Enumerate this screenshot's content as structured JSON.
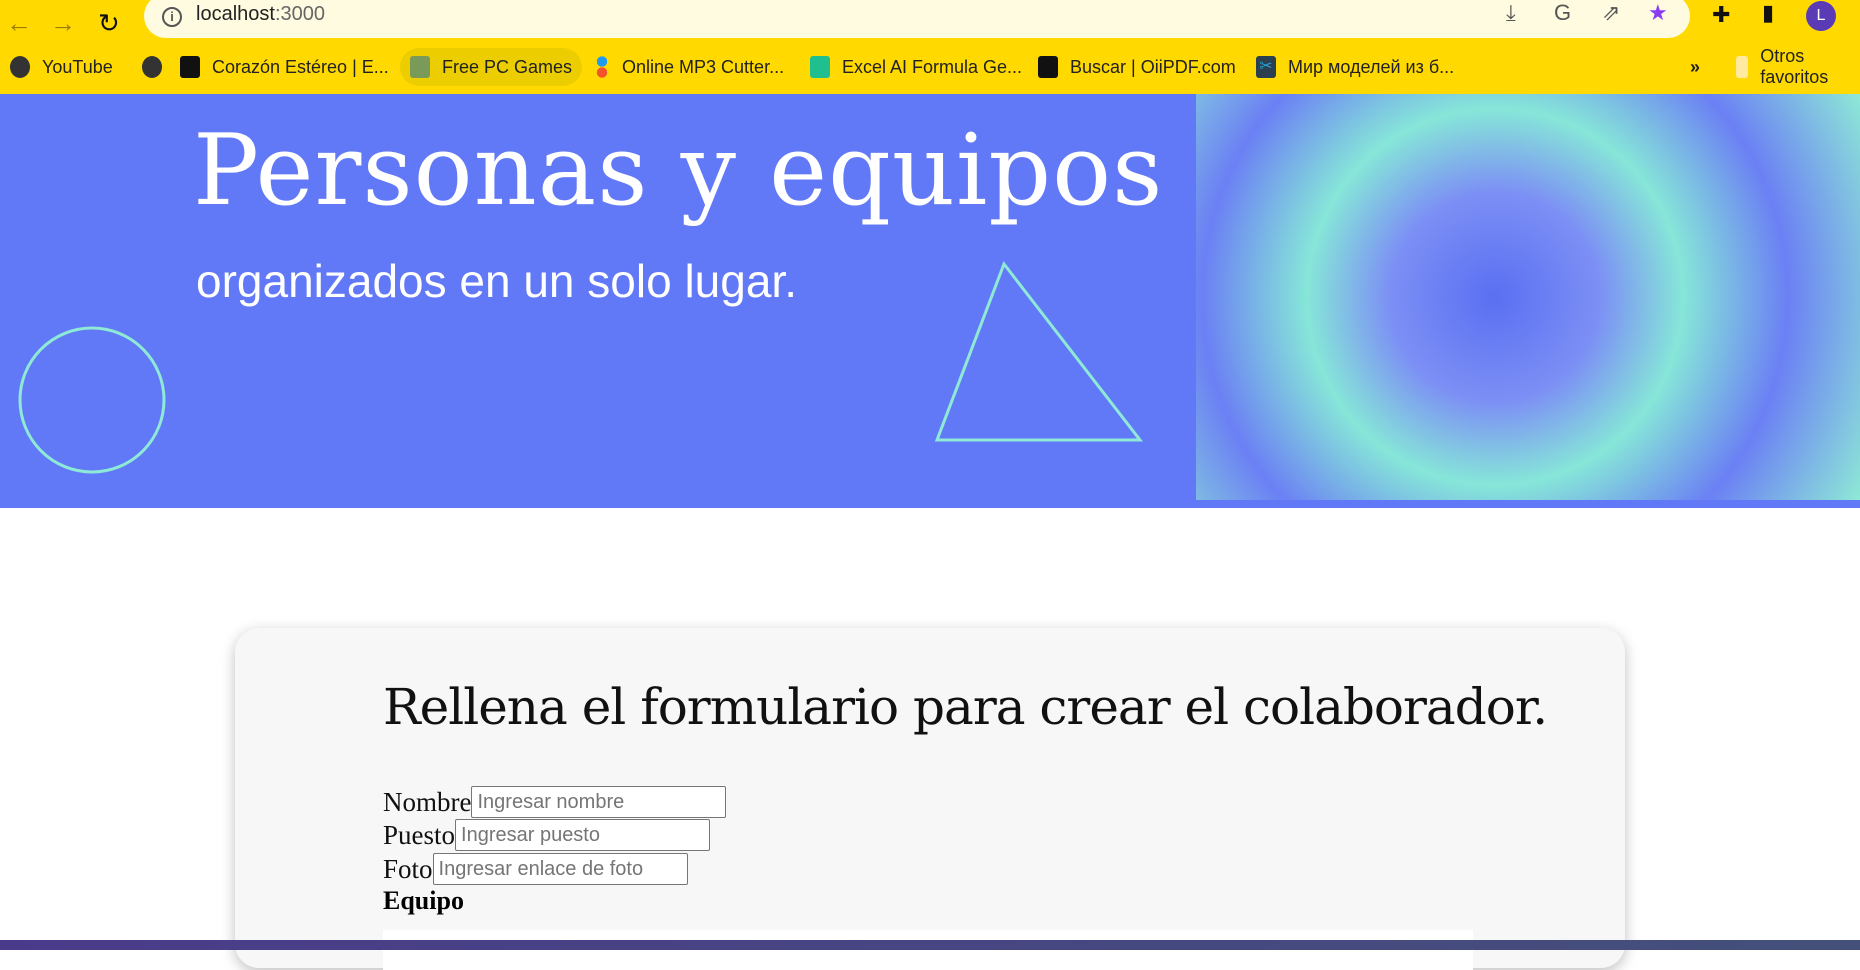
{
  "browser": {
    "url_host": "localhost",
    "url_port": ":3000",
    "bookmarks": [
      {
        "label": "YouTube",
        "color": "#333"
      },
      {
        "label": "",
        "color": "#333"
      },
      {
        "label": "Corazón Estéreo | E...",
        "color": "#111"
      },
      {
        "label": "Free PC Games",
        "color": "#7a9a5a"
      },
      {
        "label": "Online MP3 Cutter...",
        "color": "#f2542d"
      },
      {
        "label": "Excel AI Formula Ge...",
        "color": "#1fbf8f"
      },
      {
        "label": "Buscar | OiiPDF.com",
        "color": "#111"
      },
      {
        "label": "Мир моделей из б...",
        "color": "#2a9fd0"
      }
    ],
    "more": "»",
    "other_favorites": "Otros favoritos",
    "avatar_letter": "L"
  },
  "banner": {
    "title": "Personas y equipos",
    "subtitle": "organizados en un solo lugar.",
    "bg_color": "#6279f7",
    "accent_color": "#8ee9d6"
  },
  "form": {
    "title": "Rellena el formulario para crear el colaborador.",
    "fields": [
      {
        "label": "Nombre",
        "placeholder": "Ingresar nombre"
      },
      {
        "label": "Puesto",
        "placeholder": "Ingresar puesto"
      },
      {
        "label": "Foto",
        "placeholder": "Ingresar enlace de foto"
      }
    ],
    "team_label": "Equipo"
  }
}
